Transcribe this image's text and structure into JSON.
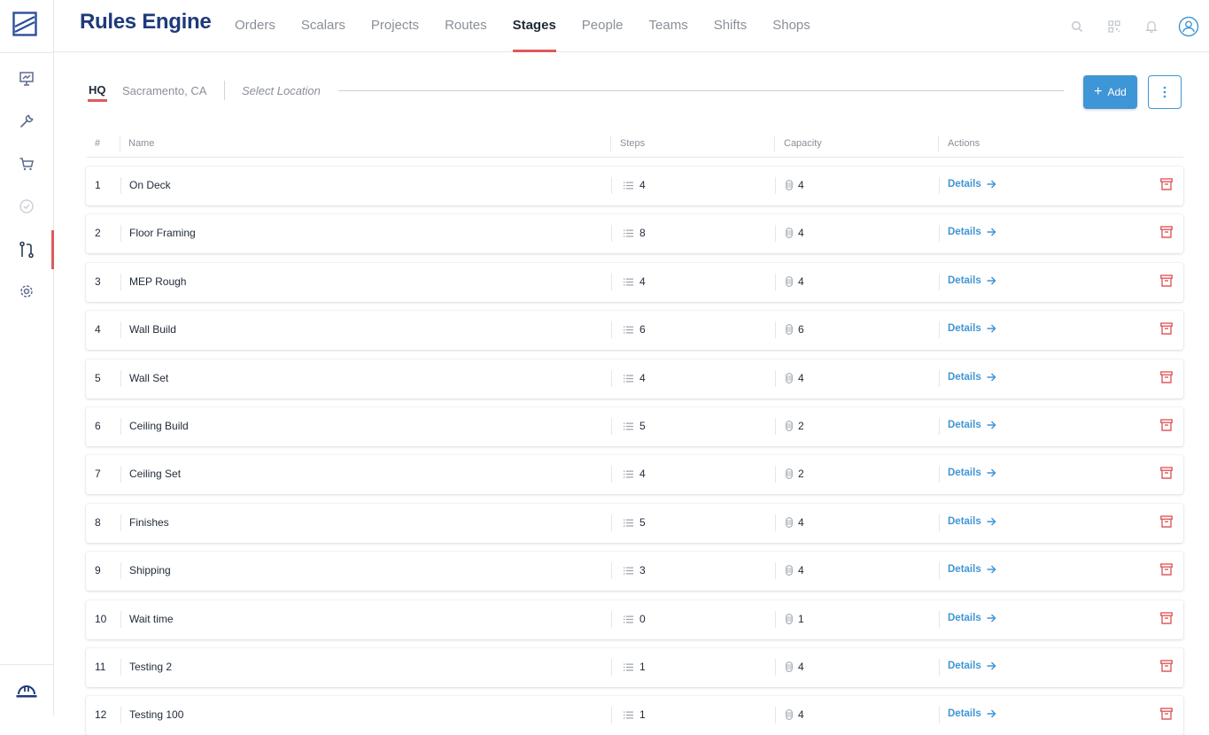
{
  "app": {
    "title": "Rules Engine"
  },
  "nav": [
    {
      "label": "Orders"
    },
    {
      "label": "Scalars"
    },
    {
      "label": "Projects"
    },
    {
      "label": "Routes"
    },
    {
      "label": "Stages",
      "active": true
    },
    {
      "label": "People"
    },
    {
      "label": "Teams"
    },
    {
      "label": "Shifts"
    },
    {
      "label": "Shops"
    }
  ],
  "sidebar": {
    "items": [
      "presentation-chart-icon",
      "wrench-icon",
      "cart-icon",
      "check-circle-icon",
      "route-icon",
      "gear-icon"
    ],
    "active_item": "route-icon",
    "bottom_item": "hard-hat-icon"
  },
  "top_icons": [
    "search-icon",
    "qr-code-icon",
    "bell-icon",
    "user-circle-icon"
  ],
  "location": {
    "hq": "HQ",
    "city": "Sacramento, CA",
    "select_placeholder": "Select Location"
  },
  "actions": {
    "add_label": "Add"
  },
  "table": {
    "headers": {
      "index": "#",
      "name": "Name",
      "steps": "Steps",
      "capacity": "Capacity",
      "actions": "Actions"
    },
    "details_label": "Details",
    "rows": [
      {
        "index": "1",
        "name": "On Deck",
        "steps": "4",
        "capacity": "4"
      },
      {
        "index": "2",
        "name": "Floor Framing",
        "steps": "8",
        "capacity": "4"
      },
      {
        "index": "3",
        "name": "MEP Rough",
        "steps": "4",
        "capacity": "4"
      },
      {
        "index": "4",
        "name": "Wall Build",
        "steps": "6",
        "capacity": "6"
      },
      {
        "index": "5",
        "name": "Wall Set",
        "steps": "4",
        "capacity": "4"
      },
      {
        "index": "6",
        "name": "Ceiling Build",
        "steps": "5",
        "capacity": "2"
      },
      {
        "index": "7",
        "name": "Ceiling Set",
        "steps": "4",
        "capacity": "2"
      },
      {
        "index": "8",
        "name": "Finishes",
        "steps": "5",
        "capacity": "4"
      },
      {
        "index": "9",
        "name": "Shipping",
        "steps": "3",
        "capacity": "4"
      },
      {
        "index": "10",
        "name": "Wait time",
        "steps": "0",
        "capacity": "1"
      },
      {
        "index": "11",
        "name": "Testing 2",
        "steps": "1",
        "capacity": "4"
      },
      {
        "index": "12",
        "name": "Testing 100",
        "steps": "1",
        "capacity": "4"
      }
    ]
  },
  "colors": {
    "brand": "#1e3a7b",
    "accent": "#e05a5a",
    "primary": "#3f96d6"
  }
}
